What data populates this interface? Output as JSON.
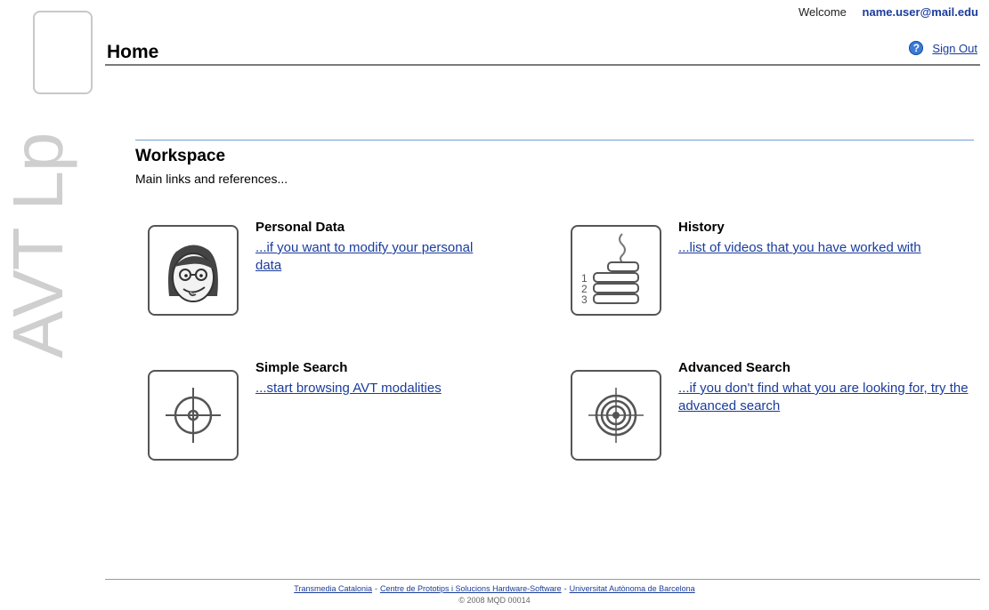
{
  "logo": {
    "text": "AVT Lp"
  },
  "header": {
    "title": "Home",
    "welcome_label": "Welcome",
    "user_email": "name.user@mail.edu",
    "sign_out_label": "Sign Out"
  },
  "workspace": {
    "title": "Workspace",
    "subtitle": "Main links and references..."
  },
  "cards": [
    {
      "title": "Personal Data",
      "link": "...if you want to modify your personal data",
      "icon": "face-icon"
    },
    {
      "title": "History",
      "link": "...list of videos that you have worked with",
      "icon": "history-list-icon"
    },
    {
      "title": "Simple Search",
      "link": "...start browsing AVT modalities",
      "icon": "crosshair-icon"
    },
    {
      "title": "Advanced Search",
      "link": "...if you don't find what you are looking for, try the advanced search",
      "icon": "target-icon"
    }
  ],
  "footer": {
    "links": [
      "Transmedia Catalonia",
      "Centre de Prototips i Solucions Hardware-Software",
      "Universitat Autònoma de Barcelona"
    ],
    "copyright": "© 2008 MQD 00014"
  },
  "colors": {
    "link": "#1a3c9c",
    "rule": "#6f9fd8",
    "logo": "#cfcfcf"
  }
}
